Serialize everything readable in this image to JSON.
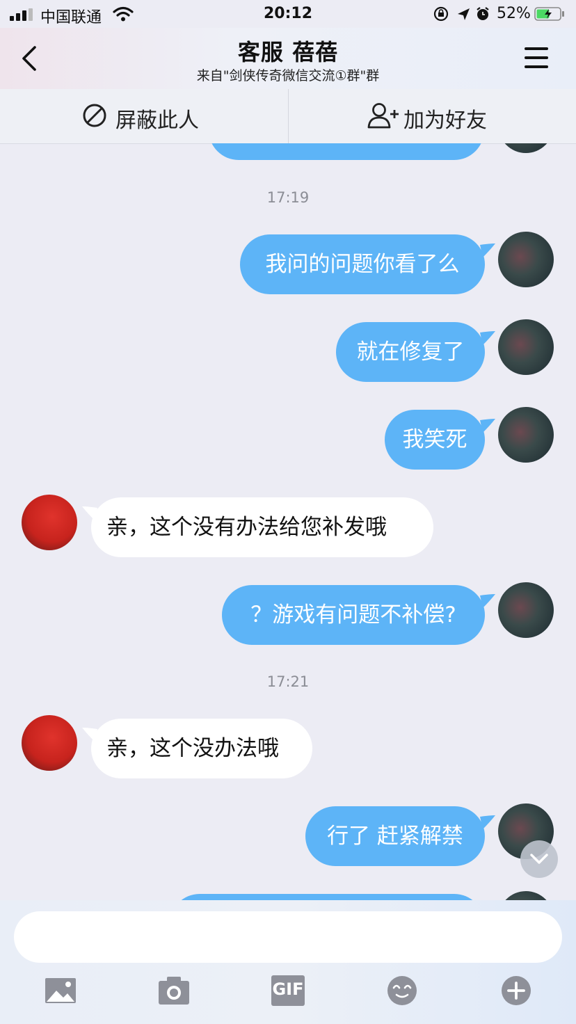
{
  "status_bar": {
    "carrier": "中国联通",
    "time": "20:12",
    "battery_percent": "52%"
  },
  "header": {
    "title": "客服 蓓蓓",
    "subtitle": "来自\"剑侠传奇微信交流①群\"群"
  },
  "actions": {
    "block_label": "屏蔽此人",
    "add_friend_label": "加为好友"
  },
  "chat": {
    "timestamps": [
      "17:19",
      "17:21"
    ],
    "messages": [
      {
        "sender": "me",
        "text": "我问的问题你看了么"
      },
      {
        "sender": "me",
        "text": "就在修复了"
      },
      {
        "sender": "me",
        "text": "我笑死"
      },
      {
        "sender": "other",
        "text": "亲，这个没有办法给您补发哦"
      },
      {
        "sender": "me",
        "text": "？游戏有问题不补偿?"
      },
      {
        "sender": "other",
        "text": "亲，这个没办法哦"
      },
      {
        "sender": "me",
        "text": "行了 赶紧解禁"
      }
    ]
  },
  "input": {
    "placeholder": ""
  },
  "toolbar": {
    "gif_label": "GIF"
  },
  "colors": {
    "outgoing_bubble": "#5db4f7",
    "incoming_bubble": "#ffffff",
    "background": "#ececf4"
  },
  "icons": [
    "signal-icon",
    "wifi-icon",
    "lock-rotation-icon",
    "location-icon",
    "alarm-icon",
    "battery-icon",
    "back-icon",
    "menu-icon",
    "block-icon",
    "add-friend-icon",
    "image-icon",
    "camera-icon",
    "gif-icon",
    "emoji-icon",
    "plus-icon",
    "chevron-down-icon"
  ]
}
